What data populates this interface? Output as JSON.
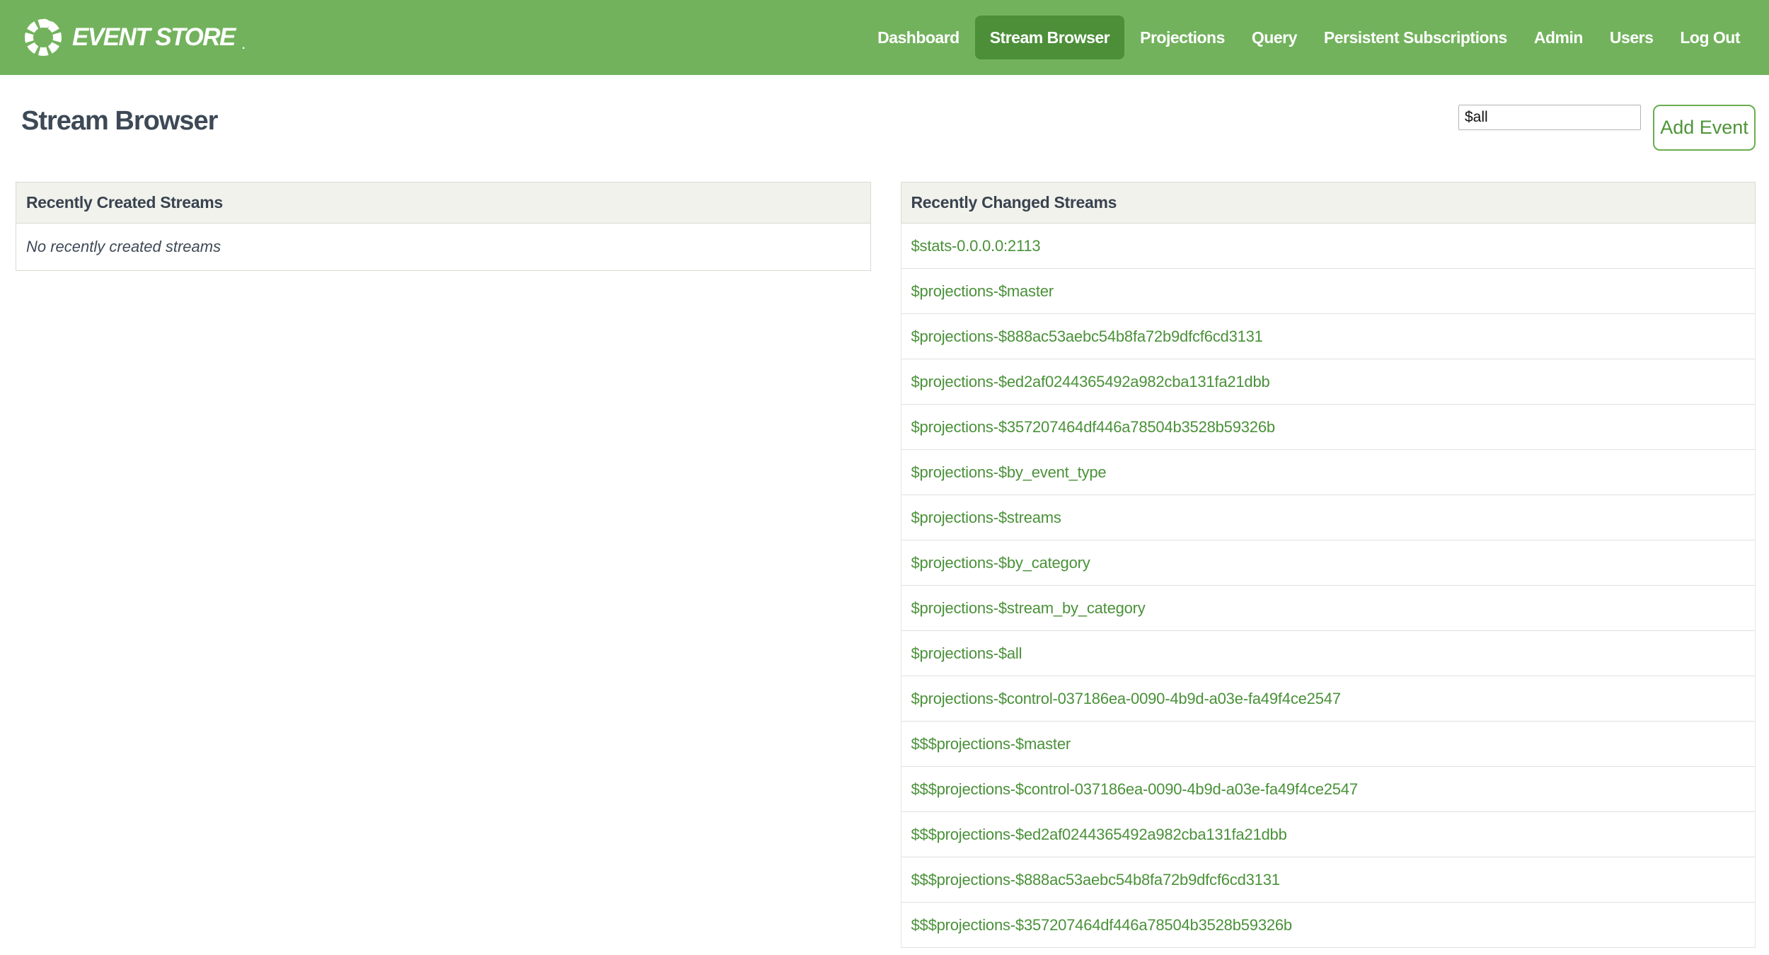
{
  "navbar": {
    "logo_text": "EVENT STORE",
    "logo_suffix": ".",
    "items": [
      {
        "label": "Dashboard",
        "active": false
      },
      {
        "label": "Stream Browser",
        "active": true
      },
      {
        "label": "Projections",
        "active": false
      },
      {
        "label": "Query",
        "active": false
      },
      {
        "label": "Persistent Subscriptions",
        "active": false
      },
      {
        "label": "Admin",
        "active": false
      },
      {
        "label": "Users",
        "active": false
      },
      {
        "label": "Log Out",
        "active": false
      }
    ]
  },
  "page": {
    "title": "Stream Browser",
    "stream_input_value": "$all",
    "add_event_label": "Add Event"
  },
  "panels": {
    "created": {
      "title": "Recently Created Streams",
      "empty_message": "No recently created streams"
    },
    "changed": {
      "title": "Recently Changed Streams",
      "streams": [
        "$stats-0.0.0.0:2113",
        "$projections-$master",
        "$projections-$888ac53aebc54b8fa72b9dfcf6cd3131",
        "$projections-$ed2af0244365492a982cba131fa21dbb",
        "$projections-$357207464df446a78504b3528b59326b",
        "$projections-$by_event_type",
        "$projections-$streams",
        "$projections-$by_category",
        "$projections-$stream_by_category",
        "$projections-$all",
        "$projections-$control-037186ea-0090-4b9d-a03e-fa49f4ce2547",
        "$$$projections-$master",
        "$$$projections-$control-037186ea-0090-4b9d-a03e-fa49f4ce2547",
        "$$$projections-$ed2af0244365492a982cba131fa21dbb",
        "$$$projections-$888ac53aebc54b8fa72b9dfcf6cd3131",
        "$$$projections-$357207464df446a78504b3528b59326b"
      ]
    }
  },
  "colors": {
    "navbar_green": "#72b25c",
    "active_nav_green": "#4c8f38",
    "link_green": "#4a9139",
    "heading_text": "#3d4956",
    "panel_header_bg": "#f1f2ec"
  }
}
